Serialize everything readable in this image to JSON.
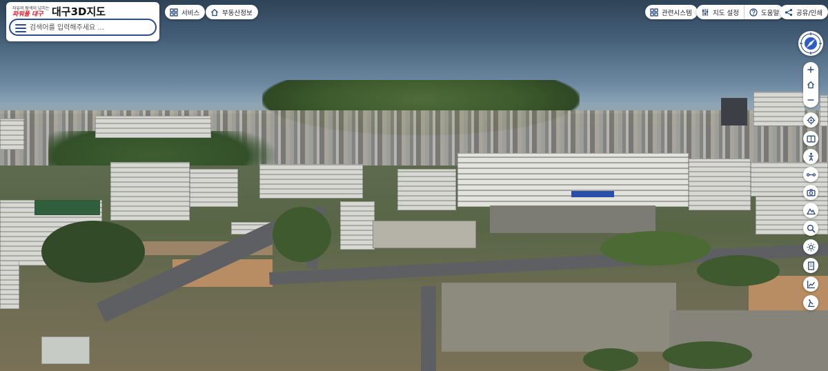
{
  "header": {
    "logo": {
      "tagline": "자유의 탐색이 넘치는",
      "brand": "파워풀 대구"
    },
    "title": "대구3D지도"
  },
  "search": {
    "placeholder": "검색어를 입력해주세요 ...",
    "value": ""
  },
  "top_buttons": {
    "services_label": "서비스",
    "real_estate_label": "부동산정보",
    "related_systems_label": "관련시스템",
    "map_settings_label": "지도 설정",
    "help_label": "도움말",
    "share_print_label": "공유/인쇄"
  },
  "right_toolbar": {
    "icons": [
      "compass-icon",
      "zoom-in-icon",
      "home-icon",
      "zoom-out-icon",
      "locate-icon",
      "view-toggle-icon",
      "pedestrian-icon",
      "measure-icon",
      "camera-icon",
      "terrain-icon",
      "search-zoom-icon",
      "sun-icon",
      "building-icon",
      "chart-icon",
      "analysis-icon"
    ]
  },
  "colors": {
    "accent": "#2b4d8d",
    "brand_red": "#e11d2a",
    "icon_blue": "#26457f"
  }
}
